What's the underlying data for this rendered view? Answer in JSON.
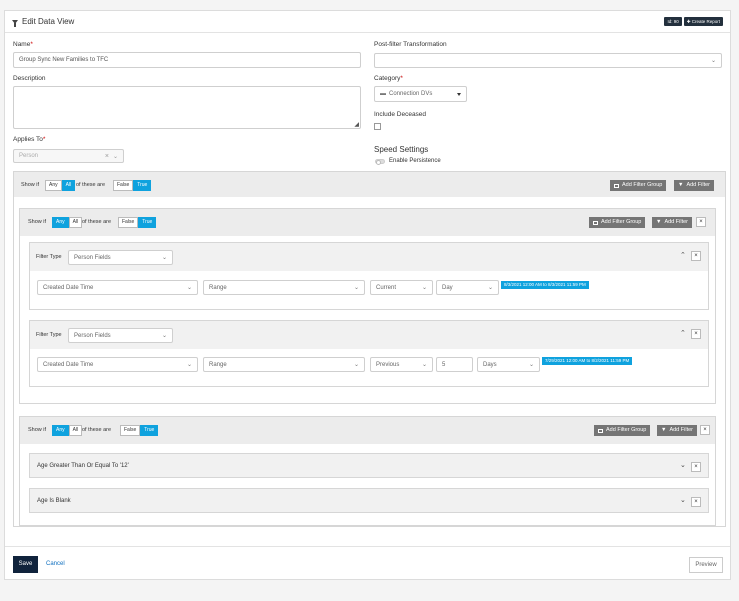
{
  "header": {
    "title": "Edit Data View",
    "id_badge": "Id: 90",
    "create_report": "Create Report"
  },
  "form": {
    "name_label": "Name",
    "name_value": "Group Sync New Families to TFC",
    "description_label": "Description",
    "applies_to_label": "Applies To",
    "applies_to_value": "Person",
    "post_filter_label": "Post-filter Transformation",
    "category_label": "Category",
    "category_value": "Connection DVs",
    "include_deceased_label": "Include Deceased",
    "speed_settings_label": "Speed Settings",
    "enable_persistence_label": "Enable Persistence"
  },
  "filter_common": {
    "show_if": "Show if",
    "any": "Any",
    "all": "All",
    "of_these_are": "of these are",
    "false": "False",
    "true": "True",
    "add_filter_group": "Add Filter Group",
    "add_filter": "Add Filter",
    "filter_type": "Filter Type"
  },
  "filters": {
    "filter1": {
      "type": "Person Fields",
      "field": "Created Date Time",
      "comparison": "Range",
      "mode": "Current",
      "unit": "Day",
      "date_range": "8/3/2021 12:00 AM to 8/3/2021 11:59 PM"
    },
    "filter2": {
      "type": "Person Fields",
      "field": "Created Date Time",
      "comparison": "Range",
      "mode": "Previous",
      "count": "5",
      "unit": "Days",
      "date_range": "7/29/2021 12:00 AM to 8/2/2021 11:59 PM"
    },
    "group2_rows": [
      "Age Greater Than Or Equal To '12'",
      "Age Is Blank"
    ]
  },
  "footer": {
    "save": "Save",
    "cancel": "Cancel",
    "preview": "Preview"
  }
}
